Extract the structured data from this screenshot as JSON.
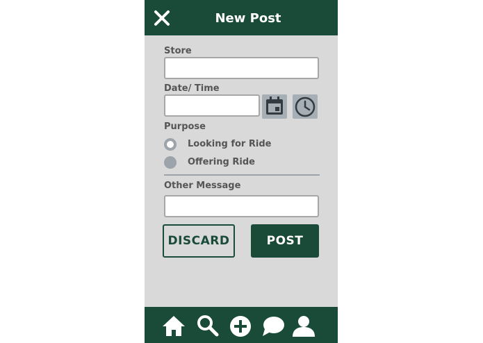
{
  "header": {
    "title": "New Post"
  },
  "form": {
    "store": {
      "label": "Store",
      "value": "",
      "placeholder": ""
    },
    "datetime": {
      "label": "Date/ Time",
      "value": "",
      "placeholder": ""
    },
    "purpose": {
      "label": "Purpose",
      "options": [
        {
          "label": "Looking for Ride",
          "selected": false
        },
        {
          "label": "Offering Ride",
          "selected": true
        }
      ]
    },
    "message": {
      "label": "Other Message",
      "value": "",
      "placeholder": ""
    }
  },
  "actions": {
    "discard_label": "DISCARD",
    "post_label": "POST"
  },
  "nav": {
    "items": [
      {
        "icon": "home-icon"
      },
      {
        "icon": "search-icon"
      },
      {
        "icon": "add-icon"
      },
      {
        "icon": "chat-icon"
      },
      {
        "icon": "profile-icon"
      }
    ]
  },
  "colors": {
    "brand": "#1a4a38",
    "background": "#d9d9d9",
    "control": "#9ca3ab"
  }
}
